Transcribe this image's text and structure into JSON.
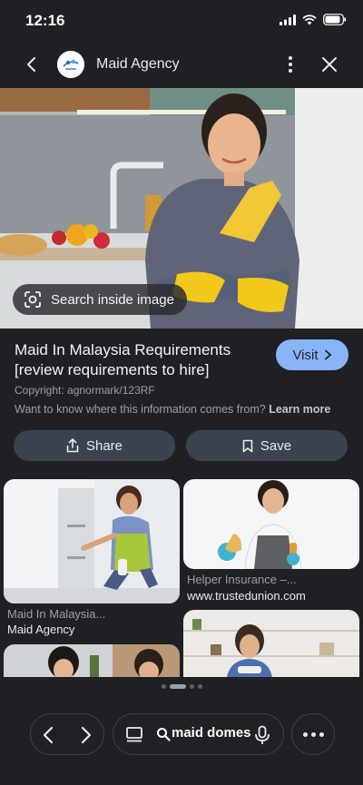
{
  "status_bar": {
    "time": "12:16"
  },
  "header": {
    "title": "Maid Agency"
  },
  "hero": {
    "search_inside_label": "Search inside image"
  },
  "result": {
    "title": "Maid In Malaysia Requirements [review requirements to hire]",
    "visit_label": "Visit",
    "copyright": "Copyright: agnormark/123RF",
    "info_text": "Want to know where this information comes from?",
    "learn_more": "Learn more"
  },
  "actions": {
    "share_label": "Share",
    "save_label": "Save"
  },
  "related": [
    {
      "title": "Maid In Malaysia...",
      "source": "Maid Agency"
    },
    {
      "title": "Helper Insurance –...",
      "source": "www.trustedunion.com"
    }
  ],
  "pager": {
    "count": 4,
    "active": 1
  },
  "bottom_bar": {
    "query": "maid domes"
  },
  "colors": {
    "background": "#1f2023",
    "accent": "#8ab4f8",
    "pill": "#3c4350"
  }
}
